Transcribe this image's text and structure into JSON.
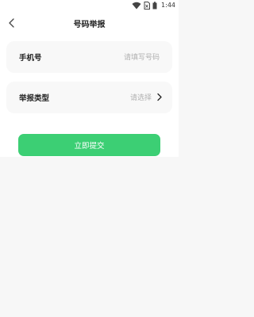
{
  "status_bar": {
    "time": "1:44"
  },
  "header": {
    "title": "号码举报"
  },
  "form": {
    "phone": {
      "label": "手机号",
      "placeholder": "请填写号码"
    },
    "report_type": {
      "label": "举报类型",
      "placeholder": "请选择"
    }
  },
  "actions": {
    "submit_label": "立即提交"
  },
  "colors": {
    "accent": "#3ccf74",
    "background": "#f7f7f7",
    "card": "#f8f8f8"
  },
  "icons": [
    "wifi-icon",
    "sim-icon",
    "battery-icon",
    "back-arrow-icon",
    "chevron-right-icon"
  ]
}
